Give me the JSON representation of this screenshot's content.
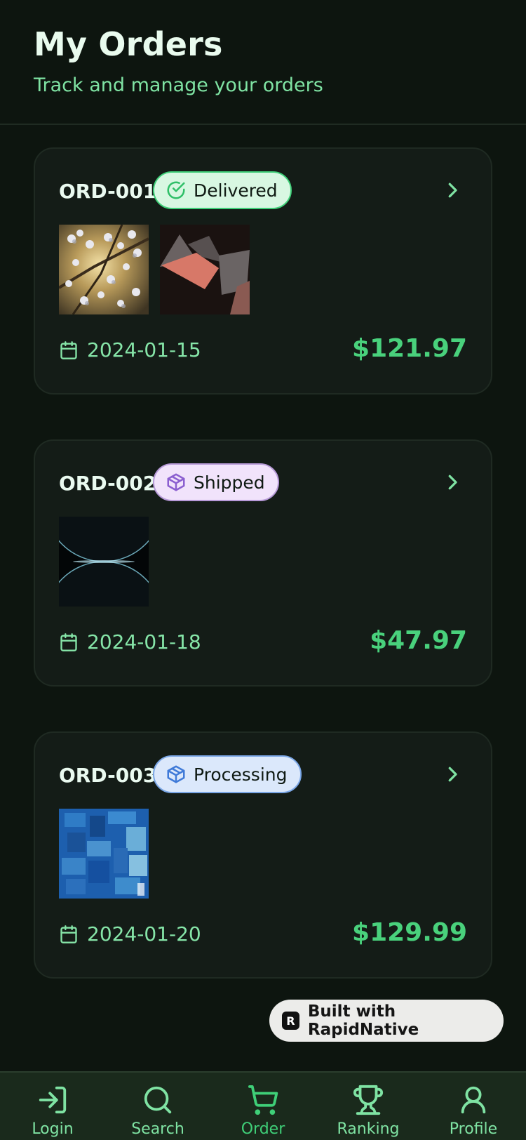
{
  "header": {
    "title": "My Orders",
    "subtitle": "Track and manage your orders"
  },
  "orders": [
    {
      "id": "ORD-001",
      "status": "Delivered",
      "status_icon": "check-circle-icon",
      "date": "2024-01-15",
      "price": "$121.97",
      "thumbnails": [
        "blossom-photo",
        "abstract-shapes"
      ]
    },
    {
      "id": "ORD-002",
      "status": "Shipped",
      "status_icon": "package-icon",
      "date": "2024-01-18",
      "price": "$47.97",
      "thumbnails": [
        "dark-spheres"
      ]
    },
    {
      "id": "ORD-003",
      "status": "Processing",
      "status_icon": "package-icon",
      "date": "2024-01-20",
      "price": "$129.99",
      "thumbnails": [
        "blue-blocks"
      ]
    }
  ],
  "badge": {
    "label": "Built with RapidNative"
  },
  "tabbar": {
    "tabs": [
      {
        "label": "Login",
        "icon": "login-icon"
      },
      {
        "label": "Search",
        "icon": "search-icon"
      },
      {
        "label": "Order",
        "icon": "cart-icon",
        "active": true
      },
      {
        "label": "Ranking",
        "icon": "trophy-icon"
      },
      {
        "label": "Profile",
        "icon": "user-icon"
      }
    ]
  },
  "colors": {
    "background": "#0d150f",
    "card": "#141c17",
    "accent": "#49d17c",
    "delivered_bg": "#d8f7e2",
    "shipped_bg": "#f1e3fb",
    "processing_bg": "#dbe8fb"
  }
}
